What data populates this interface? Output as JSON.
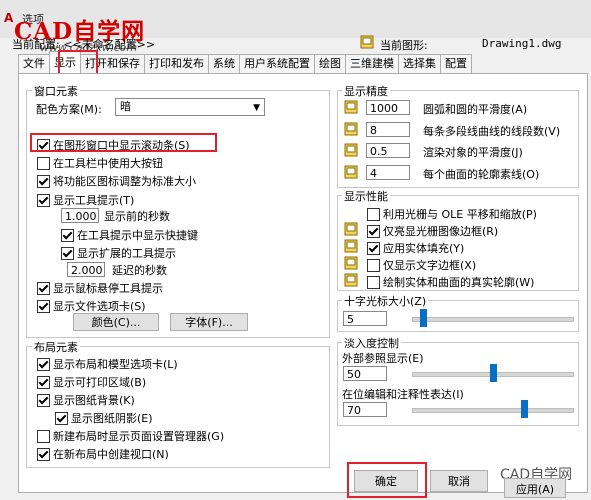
{
  "window": {
    "title": "选项",
    "watermark": "CAD自学网",
    "watermark_url": "www.cadzxw.com",
    "profile_label": "当前配置:",
    "profile_value": "<<未命名配置>>",
    "drawing_label": "当前图形:",
    "drawing_value": "Drawing1.dwg"
  },
  "tabs": [
    "文件",
    "显示",
    "打开和保存",
    "打印和发布",
    "系统",
    "用户系统配置",
    "绘图",
    "三维建模",
    "选择集",
    "配置"
  ],
  "active_tab": "显示",
  "window_elements": {
    "legend": "窗口元素",
    "color_scheme_label": "配色方案(M):",
    "color_scheme_value": "暗",
    "items": [
      {
        "label": "在图形窗口中显示滚动条(S)",
        "checked": true
      },
      {
        "label": "在工具栏中使用大按钮",
        "checked": false
      },
      {
        "label": "将功能区图标调整为标准大小",
        "checked": true
      },
      {
        "label": "显示工具提示(T)",
        "checked": true
      }
    ],
    "delay_value": "1.000",
    "delay_label": "显示前的秒数",
    "tooltip_shortcut": {
      "label": "在工具提示中显示快捷键",
      "checked": true
    },
    "tooltip_extended": {
      "label": "显示扩展的工具提示",
      "checked": true
    },
    "extended_delay_value": "2.000",
    "extended_delay_label": "延迟的秒数",
    "rollover": {
      "label": "显示鼠标悬停工具提示",
      "checked": true
    },
    "file_tabs": {
      "label": "显示文件选项卡(S)",
      "checked": true
    },
    "color_button": "颜色(C)...",
    "font_button": "字体(F)..."
  },
  "layout_elements": {
    "legend": "布局元素",
    "items": [
      {
        "label": "显示布局和模型选项卡(L)",
        "checked": true
      },
      {
        "label": "显示可打印区域(B)",
        "checked": true
      },
      {
        "label": "显示图纸背景(K)",
        "checked": true
      },
      {
        "label": "显示图纸阴影(E)",
        "checked": true
      },
      {
        "label": "新建布局时显示页面设置管理器(G)",
        "checked": false
      },
      {
        "label": "在新布局中创建视口(N)",
        "checked": true
      }
    ]
  },
  "display_resolution": {
    "legend": "显示精度",
    "rows": [
      {
        "value": "1000",
        "label": "圆弧和圆的平滑度(A)"
      },
      {
        "value": "8",
        "label": "每条多段线曲线的线段数(V)"
      },
      {
        "value": "0.5",
        "label": "渲染对象的平滑度(J)"
      },
      {
        "value": "4",
        "label": "每个曲面的轮廓素线(O)"
      }
    ]
  },
  "display_performance": {
    "legend": "显示性能",
    "items": [
      {
        "label": "利用光栅与 OLE 平移和缩放(P)",
        "checked": false,
        "icon": false
      },
      {
        "label": "仅亮显光栅图像边框(R)",
        "checked": true,
        "icon": true
      },
      {
        "label": "应用实体填充(Y)",
        "checked": true,
        "icon": true
      },
      {
        "label": "仅显示文字边框(X)",
        "checked": false,
        "icon": true
      },
      {
        "label": "绘制实体和曲面的真实轮廓(W)",
        "checked": false,
        "icon": true
      }
    ]
  },
  "crosshair": {
    "legend": "十字光标大小(Z)",
    "value": "5",
    "slider_percent": 5
  },
  "fade_control": {
    "legend": "淡入度控制",
    "xref_label": "外部参照显示(E)",
    "xref_value": "50",
    "xref_percent": 50,
    "inplace_label": "在位编辑和注释性表达(I)",
    "inplace_value": "70",
    "inplace_percent": 70
  },
  "buttons": {
    "ok": "确定",
    "cancel": "取消",
    "apply": "应用(A)",
    "brand": "CAD自学网"
  },
  "colors": {
    "highlight": "#e0202c",
    "slider_thumb": "#0a6fc2"
  }
}
